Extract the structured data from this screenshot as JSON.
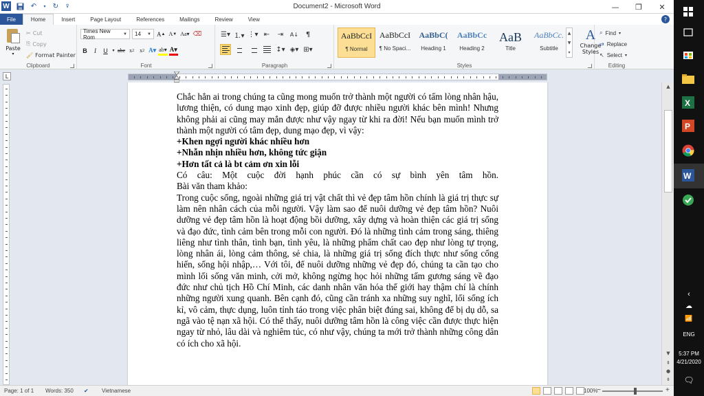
{
  "window": {
    "title": "Document2  -  Microsoft Word"
  },
  "tabs": [
    "File",
    "Home",
    "Insert",
    "Page Layout",
    "References",
    "Mailings",
    "Review",
    "View"
  ],
  "clipboard": {
    "paste": "Paste",
    "cut": "Cut",
    "copy": "Copy",
    "format_painter": "Format Painter",
    "group": "Clipboard"
  },
  "font": {
    "name": "Times New Rom",
    "size": "14",
    "group": "Font"
  },
  "paragraph": {
    "group": "Paragraph"
  },
  "styles": {
    "group": "Styles",
    "items": [
      {
        "sample": "AaBbCcI",
        "name": "¶ Normal"
      },
      {
        "sample": "AaBbCcI",
        "name": "¶ No Spaci..."
      },
      {
        "sample": "AaBbC(",
        "name": "Heading 1"
      },
      {
        "sample": "AaBbCc",
        "name": "Heading 2"
      },
      {
        "sample": "AaB",
        "name": "Title"
      },
      {
        "sample": "AaBbCc.",
        "name": "Subtitle"
      }
    ],
    "change_styles": "Change Styles"
  },
  "editing": {
    "find": "Find",
    "replace": "Replace",
    "select": "Select",
    "group": "Editing"
  },
  "document": {
    "p1": "Chắc hẳn ai trong chúng ta cũng mong muốn trở thành một người có tấm lòng nhân hậu, lương thiện, có dung mạo xinh đẹp, giúp đỡ được nhiều người khác bên mình! Nhưng không phải ai cũng may mắn được như vậy ngay từ khi ra đời! Nếu bạn muốn mình trở thành một người có tâm đẹp, dung mạo đẹp, vì vậy:",
    "b1": "+Khen ngợi người khác nhiều hơn",
    "b2": "+Nhẫn nhịn nhiều hơn, không tức giận",
    "b3": "+Hơn tất cả là bt cảm ơn xin lỗi",
    "p2": "Có câu: Một cuộc đời hạnh phúc cần có sự bình yên tâm hồn.",
    "p3": "Bài văn tham khảo:",
    "p4": "Trong cuộc sống, ngoài những giá trị vật chất thì vẻ đẹp tâm hồn chính là giá trị thực sự làm nên nhân cách của mỗi người. Vậy làm sao để nuôi dưỡng vẻ đẹp tâm hồn? Nuôi dưỡng vẻ đẹp tâm hồn là hoạt động bồi dưỡng, xây dựng và hoàn thiện các giá trị sống và đạo đức, tình cảm bên trong mỗi con người. Đó là những tình cảm trong sáng, thiêng liêng như tình thân, tình bạn, tình yêu, là những phẩm chất cao đẹp như lòng tự trọng, lòng nhân ái, lòng cảm thông, sẻ chia, là những giá trị sống đích thực như sống cống hiến, sống hội nhập,… Với tôi, để nuôi dưỡng những vẻ đẹp đó, chúng ta cần tạo cho mình lối sống văn minh, cởi mở, không ngừng học hỏi những tấm gương sáng về đạo đức như chủ tịch Hồ Chí Minh, các danh nhân văn hóa thế giới hay thậm chí là chính những người xung quanh. Bên cạnh đó, cũng cần tránh xa những suy nghĩ, lối sống ích kỉ, vô cảm, thực dụng, luôn tỉnh táo trong việc phân biệt đúng sai, không để bị dụ dỗ, sa ngã vào tệ nạn xã hội. Có thể thấy, nuôi dưỡng tâm hồn là công việc cần được thực hiện ngay từ nhỏ, lâu dài và nghiêm túc, có như vậy, chúng ta mới trở thành những công dân có ích cho xã hội."
  },
  "status": {
    "page": "Page: 1 of 1",
    "words": "Words: 350",
    "language": "Vietnamese",
    "zoom": "100%",
    "zoom_level": 1.0
  },
  "taskbar": {
    "language": "ENG",
    "time": "5:37 PM",
    "date": "4/21/2020"
  },
  "colors": {
    "word_blue": "#2b579a",
    "selected_highlight": "#fcdf95"
  }
}
